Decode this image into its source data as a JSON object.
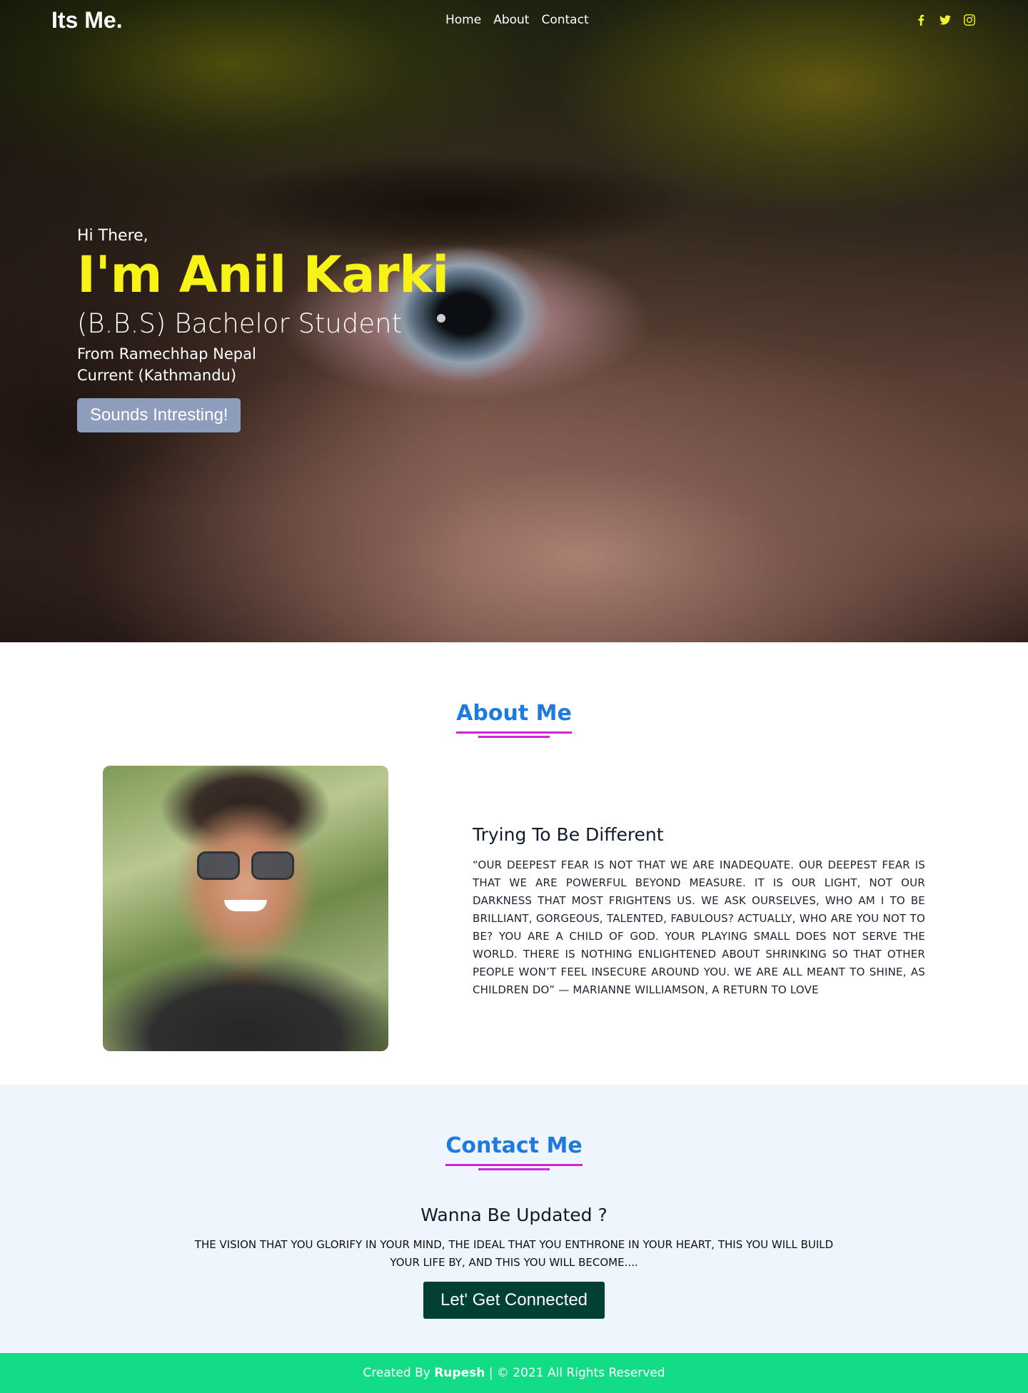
{
  "nav": {
    "brand": "Its Me.",
    "links": [
      "Home",
      "About",
      "Contact"
    ],
    "social_icons": [
      "facebook-icon",
      "twitter-icon",
      "instagram-icon"
    ],
    "accent_color": "#f4f12b"
  },
  "hero": {
    "greeting": "Hi There,",
    "name": "I'm Anil Karki",
    "degree": "(B.B.S) Bachelor Student",
    "from": "From Ramechhap Nepal",
    "current": "Current (Kathmandu)",
    "cta": "Sounds Intresting!",
    "name_color": "#f7f316"
  },
  "about": {
    "title": "About Me",
    "heading": "Trying To Be Different",
    "quote": "“Our deepest fear is not that we are inadequate. Our deepest fear is that we are powerful beyond measure. It is our light, not our darkness that most frightens us. We ask ourselves, who am I to be brilliant, gorgeous, talented, fabulous? Actually, who are you not to be? You are a child of God. Your playing small does not serve the world. There is nothing enlightened about shrinking so that other people won’t feel insecure around you. We are all meant to shine, as children do” — Marianne Williamson, A Return to Love",
    "title_color": "#1f7ae0",
    "underline_color": "#d024d8"
  },
  "contact": {
    "title": "Contact Me",
    "heading": "Wanna Be Updated ?",
    "text": "The vision that you glorify in your mind, the ideal that you enthrone in your heart, this you will build your life by, and this you will become....",
    "cta": "Let' Get Connected",
    "cta_color": "#014034",
    "bg_color": "#eef5fc"
  },
  "footer": {
    "prefix": "Created By",
    "author": "Rupesh",
    "suffix": "| © 2021 All Rights Reserved",
    "bg_color": "#13dc86"
  }
}
